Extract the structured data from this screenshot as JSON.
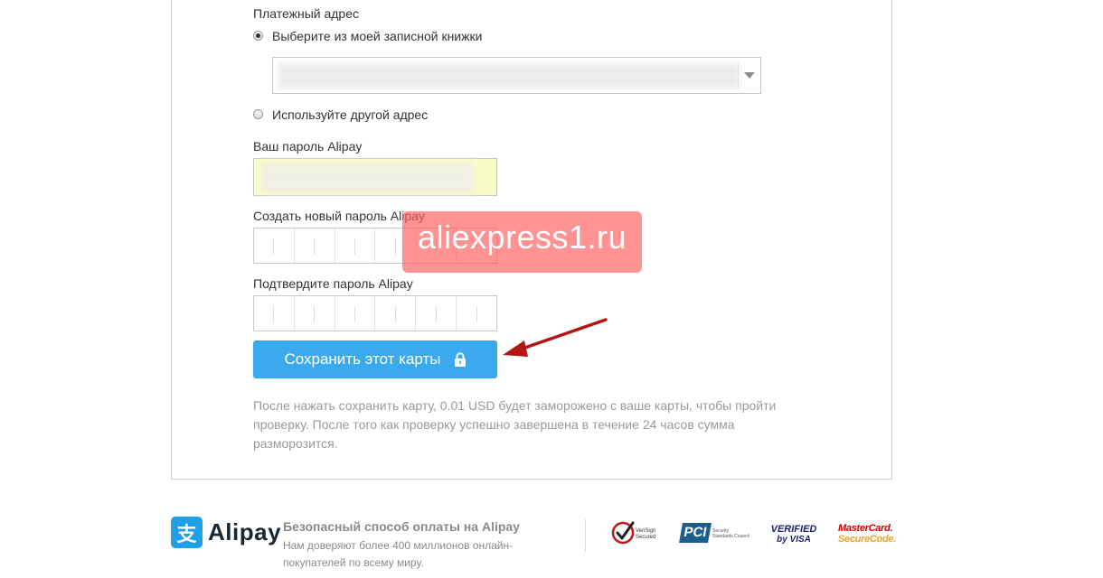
{
  "form": {
    "billing_heading": "Платежный адрес",
    "radio_address_book": "Выберите из моей записной книжки",
    "radio_other_address": "Используйте другой адрес",
    "alipay_password_label": "Ваш пароль Alipay",
    "new_password_label": "Создать новый пароль Alipay",
    "confirm_password_label": "Подтвердите пароль Alipay",
    "save_button": "Сохранить этот карты",
    "note": "После нажать сохранить карту, 0.01 USD будет заморожено с ваше карты, чтобы пройти проверку. После того как проверку успешно завершена в течение 24 часов сумма разморозится."
  },
  "watermark": "aliexpress1.ru",
  "footer": {
    "brand_mark": "支",
    "brand_name": "Alipay",
    "title": "Безопасный способ оплаты на Alipay",
    "subtitle": "Нам доверяют более 400 миллионов онлайн-покупателей по всему миру.",
    "badges": {
      "verisign": "VeriSign Secured",
      "pci": "PCI",
      "pci_sub": "Security Standards Council",
      "verified_visa_1": "VERIFIED",
      "verified_visa_2": "by VISA",
      "mastercard_1": "MasterCard.",
      "mastercard_2": "SecureCode."
    }
  },
  "colors": {
    "button": "#3aa9ee",
    "arrow": "#b31515",
    "watermark": "#ff5f5f",
    "password_fill": "#fafcc7"
  }
}
